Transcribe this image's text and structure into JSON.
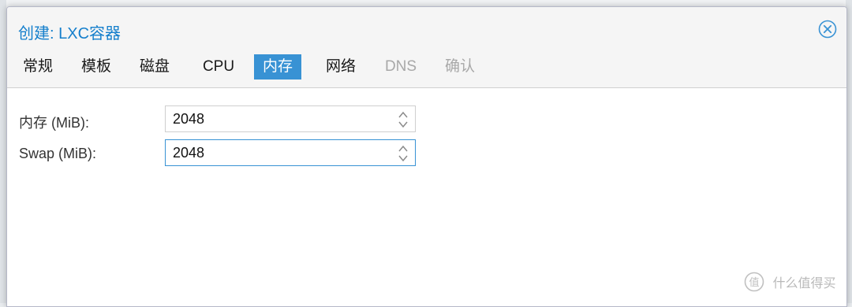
{
  "dialog": {
    "title": "创建: LXC容器"
  },
  "tabs": [
    {
      "label": "常规",
      "state": "normal"
    },
    {
      "label": "模板",
      "state": "normal"
    },
    {
      "label": "磁盘",
      "state": "normal"
    },
    {
      "label": "CPU",
      "state": "normal"
    },
    {
      "label": "内存",
      "state": "active"
    },
    {
      "label": "网络",
      "state": "normal"
    },
    {
      "label": "DNS",
      "state": "disabled"
    },
    {
      "label": "确认",
      "state": "disabled"
    }
  ],
  "form": {
    "memory": {
      "label": "内存 (MiB):",
      "value": "2048"
    },
    "swap": {
      "label": "Swap (MiB):",
      "value": "2048"
    }
  },
  "watermark": {
    "text": "什么值得买"
  },
  "colors": {
    "title": "#157fcc",
    "active_tab": "#3892d4",
    "disabled_tab": "#a8a8a8",
    "focused_border": "#3892d4"
  },
  "icons": {
    "close": "close-circle-icon",
    "spin_up": "chevron-up-icon",
    "spin_down": "chevron-down-icon"
  }
}
